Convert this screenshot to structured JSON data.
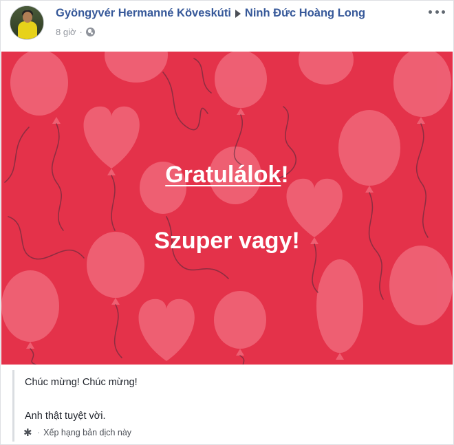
{
  "post": {
    "author": "Gyöngyvér Hermanné Köveskúti",
    "recipient": "Ninh Đức Hoàng Long",
    "time": "8 giờ",
    "separator": "·",
    "privacy_icon": "globe-icon",
    "menu_icon": "more-options-icon"
  },
  "banner": {
    "link_text": "Gratulálok",
    "exclaim": "!",
    "line2": "Szuper vagy!",
    "background_color": "#e4324a",
    "balloon_color": "#f0677a"
  },
  "translation": {
    "line1": "Chúc mừng! Chúc mừng!",
    "line2": "Anh thật tuyệt vời.",
    "rate_separator": "·",
    "rate_label": "Xếp hạng bản dịch này",
    "rate_icon": "gear-icon"
  }
}
